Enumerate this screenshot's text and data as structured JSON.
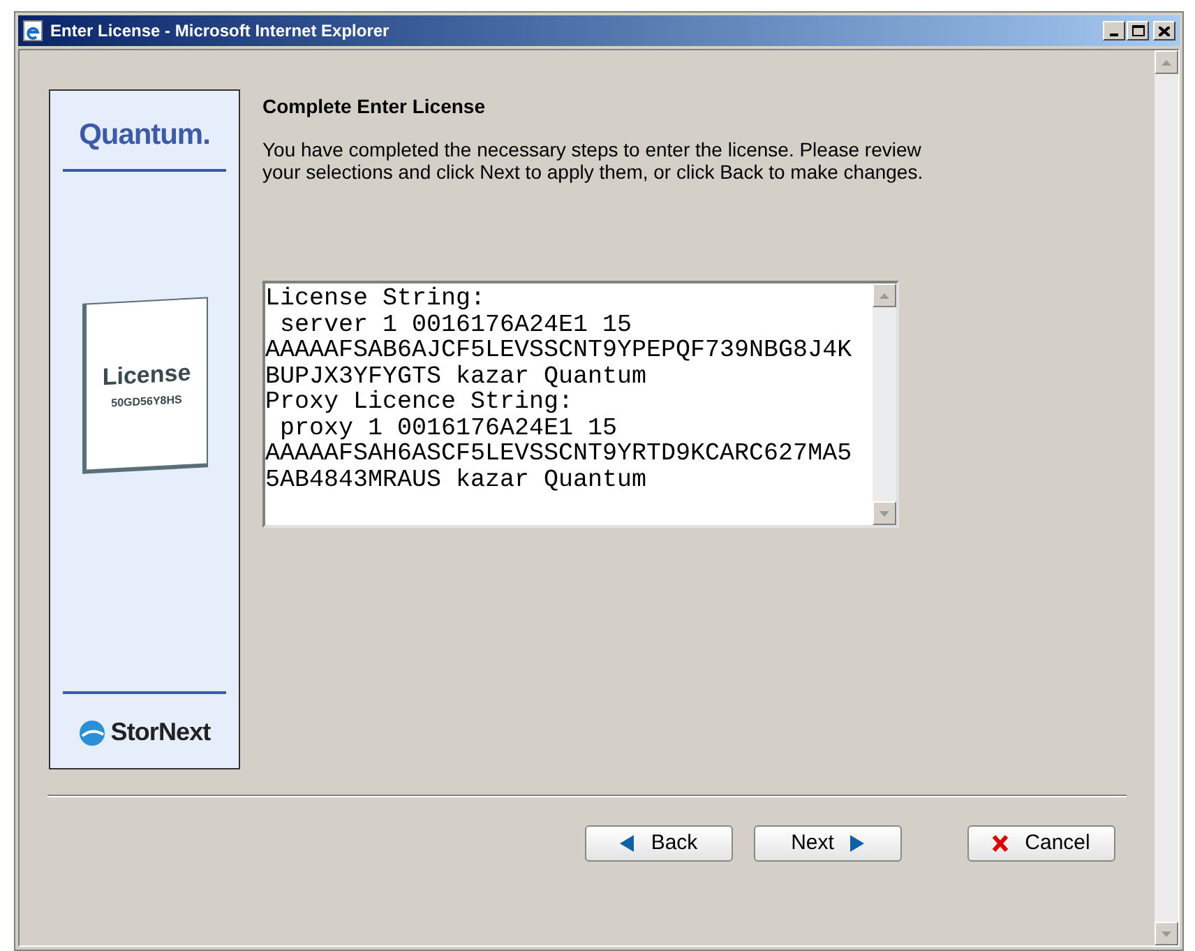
{
  "window": {
    "title": "Enter License - Microsoft Internet Explorer"
  },
  "sidebar": {
    "brand": "Quantum.",
    "license_card": {
      "label": "License",
      "code": "50GD56Y8HS"
    },
    "product": "StorNext"
  },
  "heading": "Complete Enter License",
  "description": "You have completed the necessary steps to enter the license. Please review your selections and click Next to apply them, or click Back to make changes.",
  "license_text": {
    "lines": [
      "License String:",
      " server 1 0016176A24E1 15",
      "AAAAAFSAB6AJCF5LEVSSCNT9YPEPQF739NBG8J4K",
      "BUPJX3YFYGTS kazar Quantum",
      "Proxy Licence String:",
      " proxy 1 0016176A24E1 15",
      "AAAAAFSAH6ASCF5LEVSSCNT9YRTD9KCARC627MA5",
      "5AB4843MRAUS kazar Quantum"
    ]
  },
  "buttons": [
    {
      "label": "Back",
      "kind": "back"
    },
    {
      "label": "Next",
      "kind": "next"
    },
    {
      "label": "Cancel",
      "kind": "cancel"
    }
  ]
}
